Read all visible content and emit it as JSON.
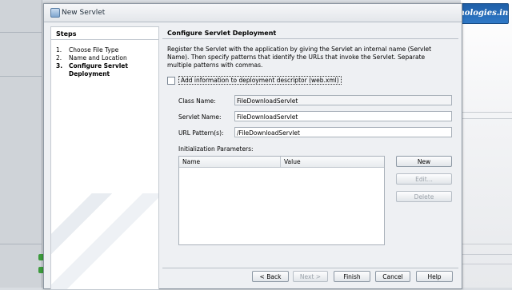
{
  "window": {
    "title": "New Servlet"
  },
  "watermark": "www.ashatechnologies.in",
  "steps": {
    "header": "Steps",
    "items": [
      {
        "num": "1.",
        "label": "Choose File Type"
      },
      {
        "num": "2.",
        "label": "Name and Location"
      },
      {
        "num": "3.",
        "label": "Configure Servlet Deployment"
      }
    ]
  },
  "main": {
    "title": "Configure Servlet Deployment",
    "description": "Register the Servlet with the application by giving the Servlet an internal name (Servlet Name). Then specify patterns that identify the URLs that invoke the Servlet. Separate multiple patterns with commas.",
    "checkbox_label": "Add information to deployment descriptor (web.xml)",
    "fields": {
      "class_name": {
        "label": "Class Name:",
        "value": "FileDownloadServlet"
      },
      "servlet_name": {
        "label": "Servlet Name:",
        "value": "FileDownloadServlet"
      },
      "url_pattern": {
        "label": "URL Pattern(s):",
        "value": "/FileDownloadServlet"
      }
    },
    "init_params": {
      "label": "Initialization Parameters:",
      "columns": [
        "Name",
        "Value"
      ]
    },
    "side_buttons": {
      "new": "New",
      "edit": "Edit...",
      "delete": "Delete"
    }
  },
  "footer": {
    "back": "< Back",
    "next": "Next >",
    "finish": "Finish",
    "cancel": "Cancel",
    "help": "Help"
  }
}
